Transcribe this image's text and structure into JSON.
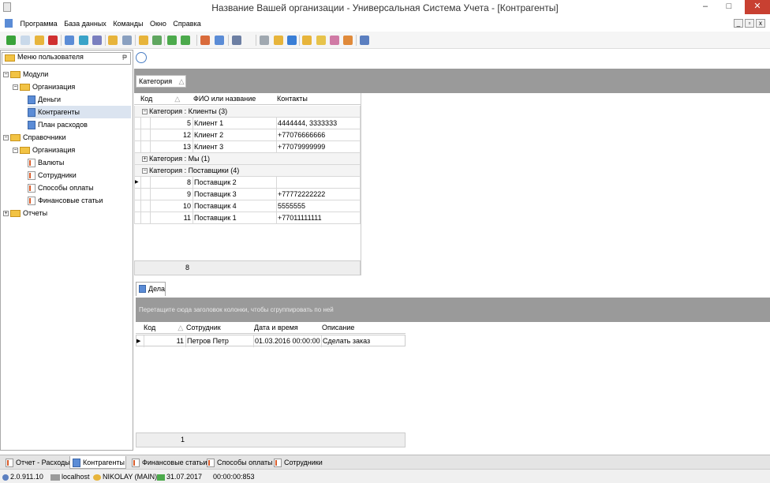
{
  "window": {
    "title": "Название Вашей организации - Универсальная Система Учета - [Контрагенты]",
    "minimize": "–",
    "maximize": "□",
    "close": "✕"
  },
  "menu": {
    "items": [
      "Программа",
      "База данных",
      "Команды",
      "Окно",
      "Справка"
    ]
  },
  "left_panel": {
    "title": "Меню пользователя",
    "pin": "₱"
  },
  "tree": [
    {
      "label": "Модули",
      "toggle": "−",
      "icon": "folder"
    },
    {
      "label": "Организация",
      "toggle": "−",
      "icon": "folder"
    },
    {
      "label": "Деньги",
      "icon": "doc"
    },
    {
      "label": "Контрагенты",
      "icon": "doc"
    },
    {
      "label": "План расходов",
      "icon": "doc"
    },
    {
      "label": "Справочники",
      "toggle": "−",
      "icon": "folder"
    },
    {
      "label": "Организация",
      "toggle": "−",
      "icon": "folder"
    },
    {
      "label": "Валюты",
      "icon": "list"
    },
    {
      "label": "Сотрудники",
      "icon": "list"
    },
    {
      "label": "Способы оплаты",
      "icon": "list"
    },
    {
      "label": "Финансовые статьи",
      "icon": "list"
    },
    {
      "label": "Отчеты",
      "toggle": "+",
      "icon": "folder"
    }
  ],
  "grid1": {
    "group_chip": "Категория",
    "sort_arrow": "△",
    "columns": [
      "Код",
      "ФИО или название",
      "Контакты"
    ],
    "groups": [
      {
        "label": "Категория : Клиенты (3)",
        "toggle": "−",
        "rows": [
          {
            "code": "5",
            "name": "Клиент 1",
            "contacts": "4444444, 3333333"
          },
          {
            "code": "12",
            "name": "Клиент 2",
            "contacts": "+77076666666"
          },
          {
            "code": "13",
            "name": "Клиент 3",
            "contacts": "+77079999999"
          }
        ]
      },
      {
        "label": "Категория : Мы (1)",
        "toggle": "+",
        "rows": []
      },
      {
        "label": "Категория : Поставщики (4)",
        "toggle": "−",
        "rows": [
          {
            "code": "8",
            "name": "Поставщик 2",
            "contacts": ""
          },
          {
            "code": "9",
            "name": "Поставщик 3",
            "contacts": "+77772222222"
          },
          {
            "code": "10",
            "name": "Поставщик 4",
            "contacts": "5555555"
          },
          {
            "code": "11",
            "name": "Поставщик 1",
            "contacts": "+77011111111"
          }
        ]
      }
    ],
    "footer_count": "8"
  },
  "detail": {
    "tab": "Дела",
    "group_hint": "Перетащите сюда заголовок колонки, чтобы сгруппировать по ней",
    "columns": [
      "Код",
      "Сотрудник",
      "Дата и время",
      "Описание"
    ],
    "rows": [
      {
        "code": "11",
        "employee": "Петров Петр",
        "datetime": "01.03.2016 00:00:00",
        "description": "Сделать заказ"
      }
    ],
    "footer_count": "1"
  },
  "doc_tabs": [
    "Отчет - Расходы",
    "Контрагенты",
    "Финансовые статьи",
    "Способы оплаты",
    "Сотрудники"
  ],
  "status": {
    "version": "2.0.911.10",
    "server": "localhost",
    "user": "NIKOLAY (MAIN)",
    "date": "31.07.2017",
    "timer": "00:00:00:853"
  },
  "colors": {
    "accent": "#5b8cd6",
    "folder": "#f2c344",
    "group_panel": "#9a9a9a",
    "close": "#c84031"
  }
}
